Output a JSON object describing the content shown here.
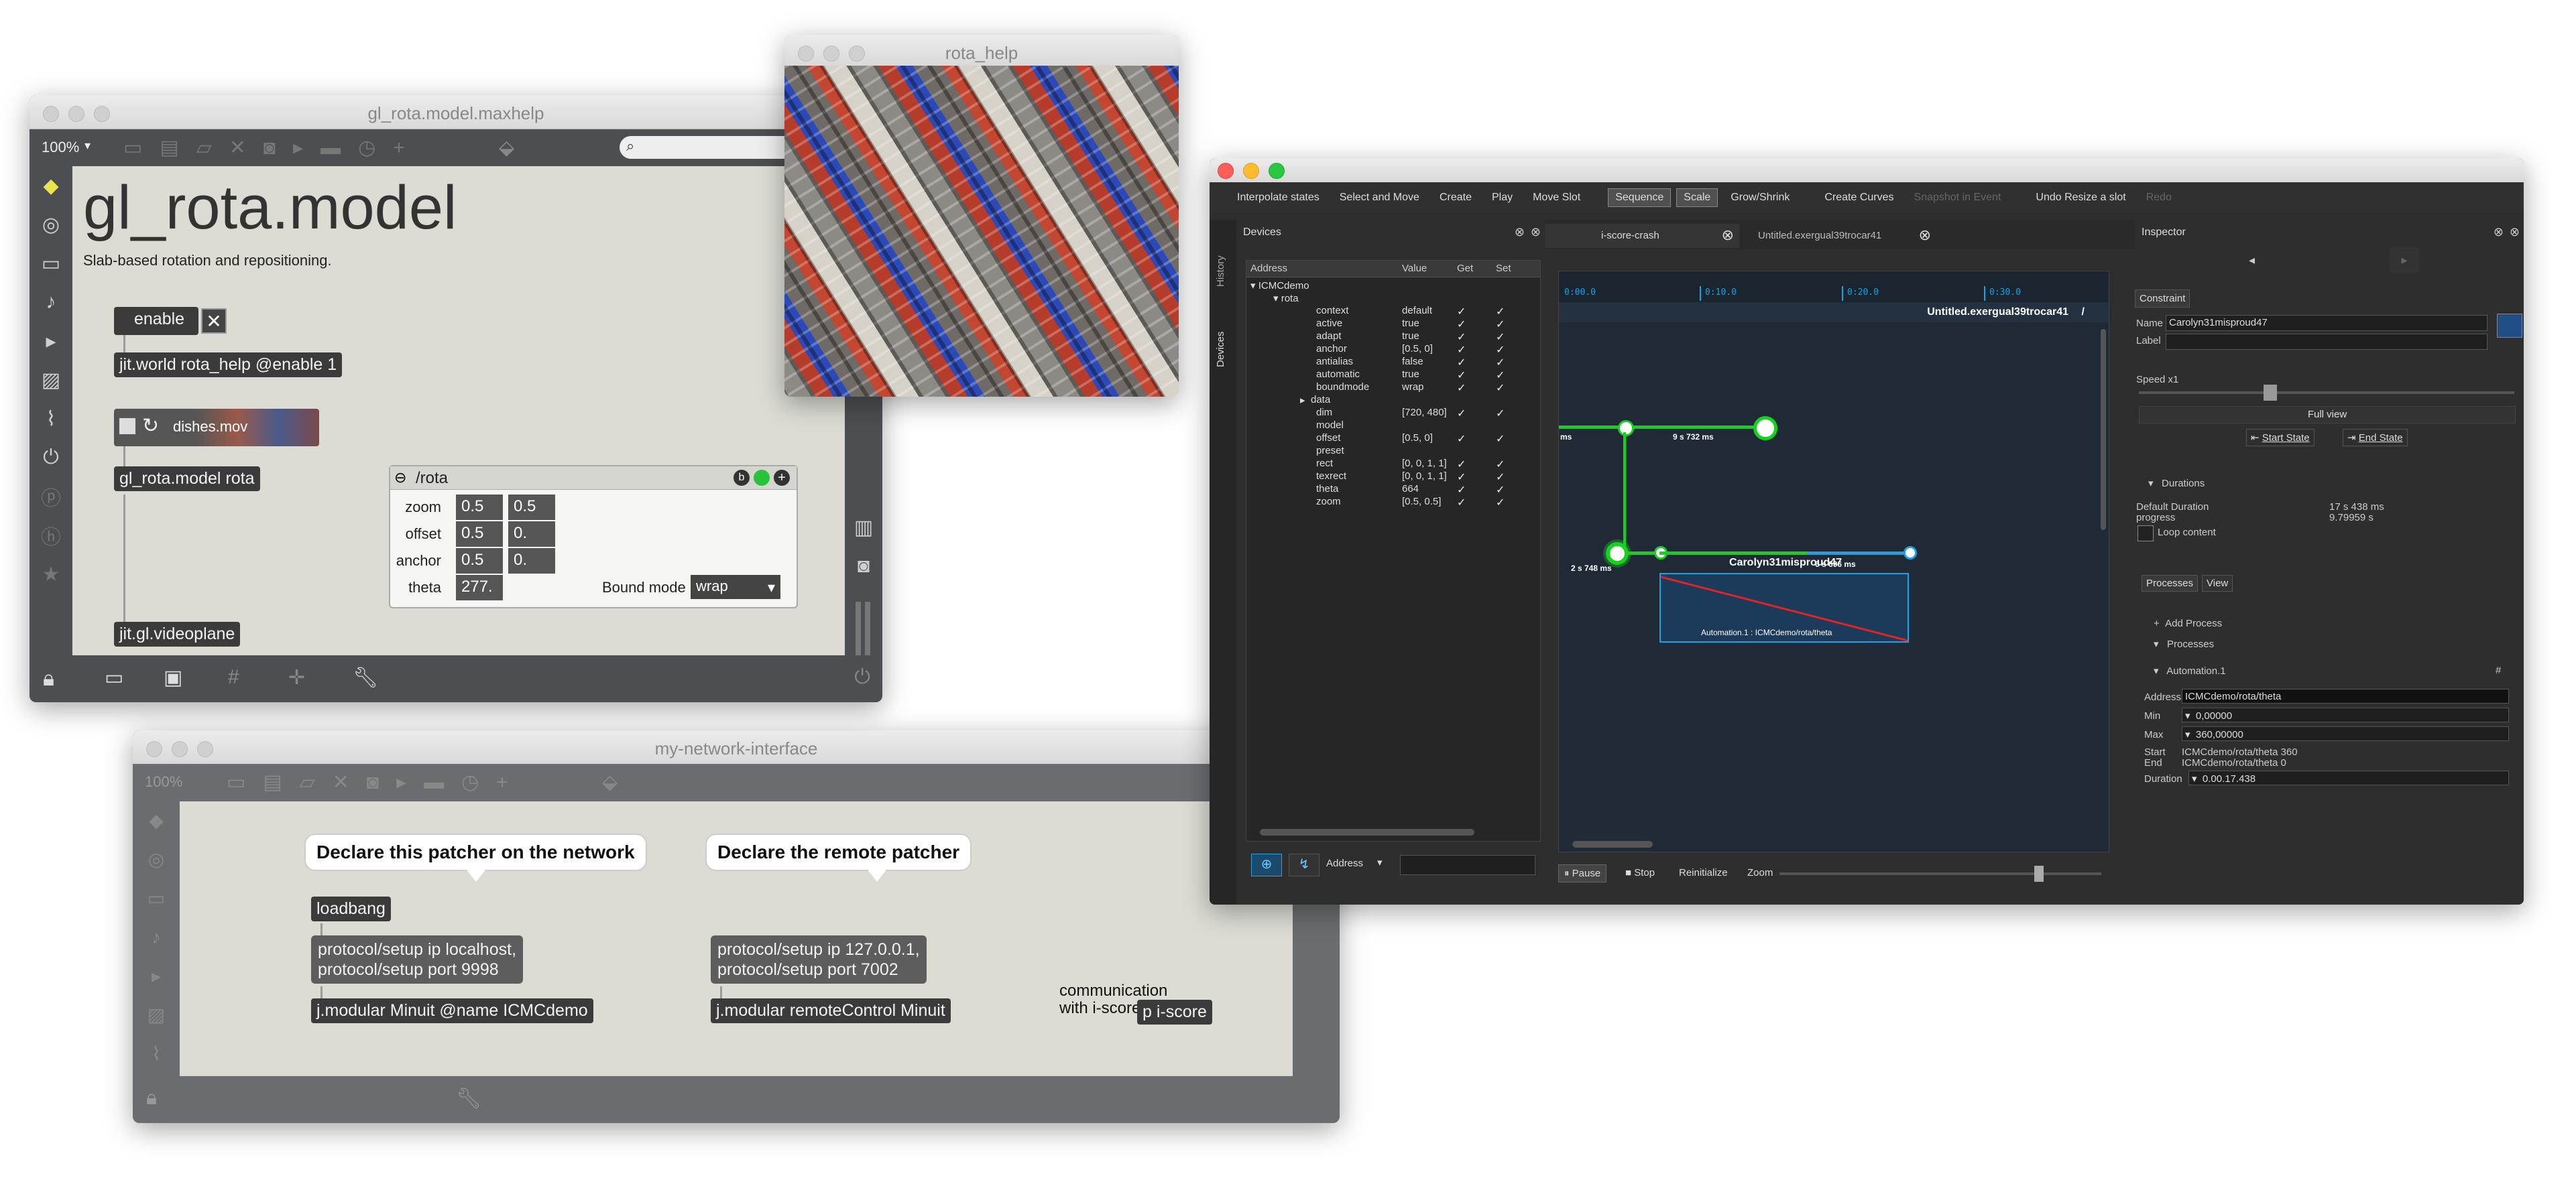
{
  "rota_help": {
    "title": "rota_help"
  },
  "gl_rota": {
    "title": "gl_rota.model.maxhelp",
    "zoom": "100%",
    "heading": "gl_rota.model",
    "description": "Slab-based rotation and repositioning.",
    "toggle_label": "enable",
    "obj_world": "jit.world rota_help @enable 1",
    "movie_label": "dishes.mov",
    "obj_model": "gl_rota.model rota",
    "obj_videoplane": "jit.gl.videoplane",
    "panel": {
      "title": "/rota",
      "rows": [
        {
          "label": "zoom",
          "v1": "0.5",
          "v2": "0.5"
        },
        {
          "label": "offset",
          "v1": "0.5",
          "v2": "0."
        },
        {
          "label": "anchor",
          "v1": "0.5",
          "v2": "0."
        },
        {
          "label": "theta",
          "v1": "277.",
          "v2": ""
        }
      ],
      "bound_label": "Bound mode",
      "bound_value": "wrap"
    }
  },
  "network": {
    "title": "my-network-interface",
    "zoom": "100%",
    "bubble_left": "Declare this patcher on the network",
    "bubble_right": "Declare the remote patcher",
    "loadbang": "loadbang",
    "msg_local": "protocol/setup ip localhost,\nprotocol/setup port 9998",
    "obj_minuit": "j.modular Minuit @name ICMCdemo",
    "msg_remote": "protocol/setup ip 127.0.0.1,\nprotocol/setup port 7002",
    "obj_remote": "j.modular remoteControl Minuit",
    "comment": "communication\nwith i-score:",
    "obj_pscore": "p i-score"
  },
  "score": {
    "toolbar": [
      {
        "label": "Interpolate states",
        "state": ""
      },
      {
        "label": "Select and Move",
        "state": ""
      },
      {
        "label": "Create",
        "state": ""
      },
      {
        "label": "Play",
        "state": ""
      },
      {
        "label": "Move Slot",
        "state": ""
      },
      {
        "label": "Sequence",
        "state": "on"
      },
      {
        "label": "Scale",
        "state": "on"
      },
      {
        "label": "Grow/Shrink",
        "state": ""
      },
      {
        "label": "Create Curves",
        "state": ""
      },
      {
        "label": "Snapshot in Event",
        "state": "dis"
      },
      {
        "label": "Undo Resize a slot",
        "state": ""
      },
      {
        "label": "Redo",
        "state": "dis"
      }
    ],
    "side_tabs": [
      "History",
      "Devices"
    ],
    "devices": {
      "title": "Devices",
      "headers": [
        "Address",
        "Value",
        "Get",
        "Set"
      ],
      "root": "ICMCdemo",
      "node": "rota",
      "rows": [
        {
          "name": "context",
          "value": "default"
        },
        {
          "name": "active",
          "value": "true"
        },
        {
          "name": "adapt",
          "value": "true"
        },
        {
          "name": "anchor",
          "value": "[0.5, 0]"
        },
        {
          "name": "antialias",
          "value": "false"
        },
        {
          "name": "automatic",
          "value": "true"
        },
        {
          "name": "boundmode",
          "value": "wrap"
        },
        {
          "name": "data",
          "value": ""
        },
        {
          "name": "dim",
          "value": "[720, 480]"
        },
        {
          "name": "model",
          "value": ""
        },
        {
          "name": "offset",
          "value": "[0.5, 0]"
        },
        {
          "name": "preset",
          "value": ""
        },
        {
          "name": "rect",
          "value": "[0, 0, 1, 1]"
        },
        {
          "name": "texrect",
          "value": "[0, 0, 1, 1]"
        },
        {
          "name": "theta",
          "value": "664"
        },
        {
          "name": "zoom",
          "value": "[0.5, 0.5]"
        }
      ],
      "checkmark": "✓",
      "address_select": "Address"
    },
    "tabs": [
      "i-score-crash",
      "Untitled.exergual39trocar41"
    ],
    "timeline": {
      "ticks": [
        "0:00.0",
        "0:10.0",
        "0:20.0",
        "0:30.0"
      ],
      "scenario_name": "Untitled.exergual39trocar41",
      "scenario_sep": "/",
      "label_a": "9 s 732 ms",
      "label_b": "2 s 748 ms",
      "label_c": "6 s 696 ms",
      "box_title": "Carolyn31misproud47",
      "automation": "Automation.1 : ICMCdemo/rota/theta",
      "ms": "ms"
    },
    "transport": {
      "pause": "Pause",
      "stop": "Stop",
      "reinit": "Reinitialize",
      "zoom": "Zoom"
    },
    "inspector": {
      "title": "Inspector",
      "tab": "Constraint",
      "name_label": "Name",
      "name_value": "Carolyn31misproud47",
      "label_label": "Label",
      "speed": "Speed x1",
      "full_view": "Full view",
      "start_state": "Start State",
      "end_state": "End State",
      "durations": "Durations",
      "default_duration_label": "Default Duration",
      "default_duration": "17 s 438 ms",
      "progress_label": "progress",
      "progress": "9.79959 s",
      "loop": "Loop content",
      "tabs2": [
        "Processes",
        "View"
      ],
      "add_process": "Add Process",
      "processes": "Processes",
      "automation_name": "Automation.1",
      "hash": "#",
      "address_label": "Address",
      "address_value": "ICMCdemo/rota/theta",
      "min_label": "Min",
      "min_value": "0,00000",
      "max_label": "Max",
      "max_value": "360,00000",
      "start_label": "Start",
      "start_value": "ICMCdemo/rota/theta 360",
      "end_label": "End",
      "end_value": "ICMCdemo/rota/theta 0",
      "duration_label": "Duration",
      "duration_value": "0.00.17.438"
    }
  },
  "colors": {
    "accent_green": "#14d21e",
    "timeline_blue": "#1d9fe0",
    "automation_red": "#e02424"
  }
}
